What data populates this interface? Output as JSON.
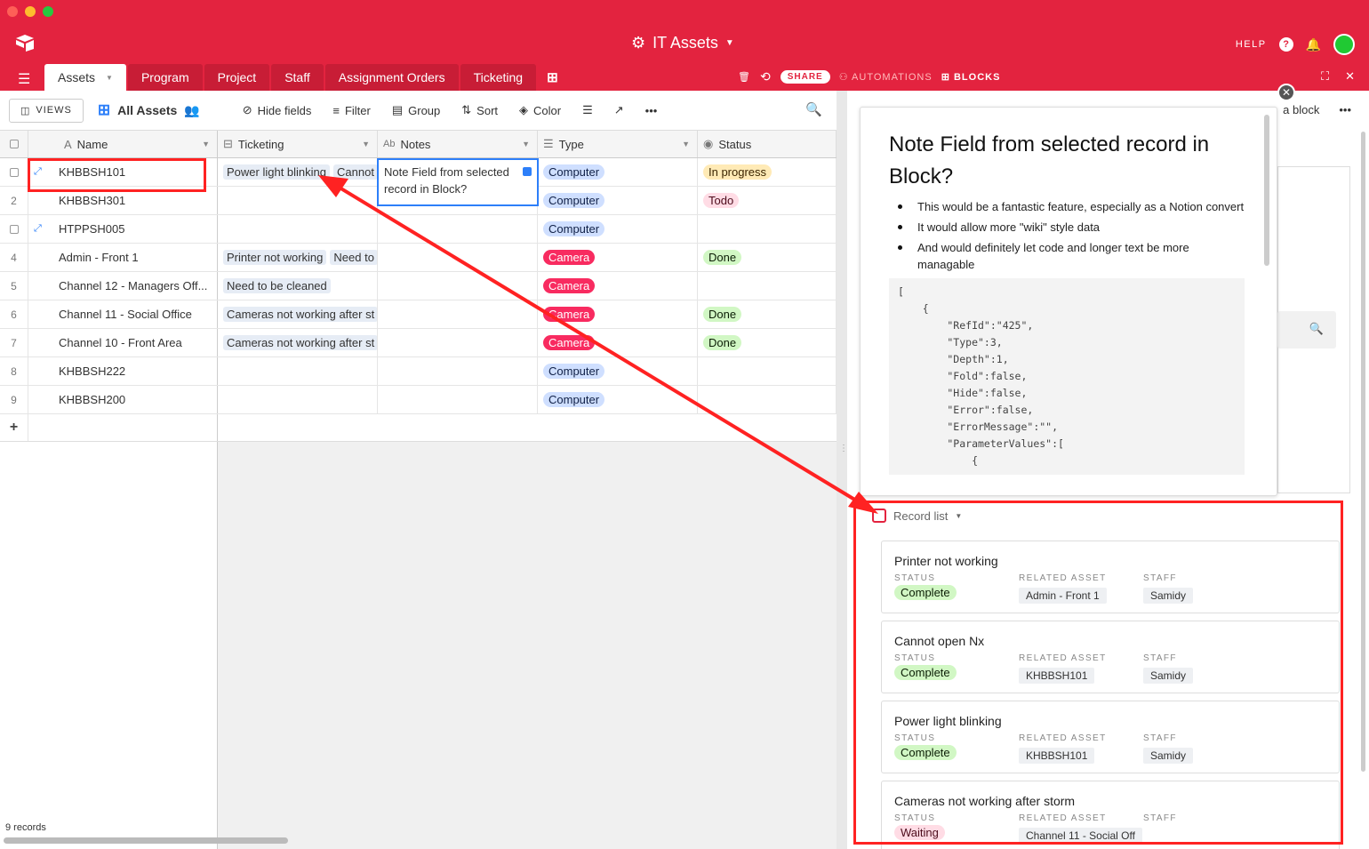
{
  "app": {
    "title": "IT Assets",
    "help": "HELP"
  },
  "tabs": [
    "Assets",
    "Program",
    "Project",
    "Staff",
    "Assignment Orders",
    "Ticketing"
  ],
  "toolbar": {
    "share": "SHARE",
    "automations": "AUTOMATIONS",
    "blocks": "BLOCKS"
  },
  "view": {
    "views_label": "VIEWS",
    "name": "All Assets",
    "tools": [
      "Hide fields",
      "Filter",
      "Group",
      "Sort",
      "Color"
    ]
  },
  "columns": [
    "Name",
    "Ticketing",
    "Notes",
    "Type",
    "Status"
  ],
  "rows": [
    {
      "num": "",
      "name": "KHBBSH101",
      "tickets": [
        "Power light blinking",
        "Cannot"
      ],
      "notes": "",
      "type": "Computer",
      "status": "In progress"
    },
    {
      "num": "2",
      "name": "KHBBSH301",
      "tickets": [],
      "notes": "",
      "type": "Computer",
      "status": "Todo"
    },
    {
      "num": "",
      "name": "HTPPSH005",
      "tickets": [],
      "notes": "",
      "type": "Computer",
      "status": ""
    },
    {
      "num": "4",
      "name": "Admin - Front 1",
      "tickets": [
        "Printer not working",
        "Need to"
      ],
      "notes": "",
      "type": "Camera",
      "status": "Done"
    },
    {
      "num": "5",
      "name": "Channel 12 - Managers Off...",
      "tickets": [
        "Need to be cleaned"
      ],
      "notes": "",
      "type": "Camera",
      "status": ""
    },
    {
      "num": "6",
      "name": "Channel 11 - Social Office",
      "tickets": [
        "Cameras not working after st"
      ],
      "notes": "",
      "type": "Camera",
      "status": "Done"
    },
    {
      "num": "7",
      "name": "Channel 10 - Front Area",
      "tickets": [
        "Cameras not working after st"
      ],
      "notes": "",
      "type": "Camera",
      "status": "Done"
    },
    {
      "num": "8",
      "name": "KHBBSH222",
      "tickets": [],
      "notes": "",
      "type": "Computer",
      "status": ""
    },
    {
      "num": "9",
      "name": "KHBBSH200",
      "tickets": [],
      "notes": "",
      "type": "Computer",
      "status": ""
    }
  ],
  "add_row": "+",
  "expanded_note": "Note Field from selected record in Block?",
  "footer": "9 records",
  "right_header": {
    "add_block": "a block",
    "more": "•••"
  },
  "block": {
    "title": "Note Field from selected record in Block?",
    "bullets": [
      "This would be a fantastic feature, especially as a Notion convert",
      "It would allow more \"wiki\" style data",
      "And would definitely let code and longer text be more managable"
    ],
    "code": "[\n    {\n        \"RefId\":\"425\",\n        \"Type\":3,\n        \"Depth\":1,\n        \"Fold\":false,\n        \"Hide\":false,\n        \"Error\":false,\n        \"ErrorMessage\":\"\",\n        \"ParameterValues\":[\n            {"
  },
  "record_list": {
    "label": "Record list",
    "labels": {
      "status": "STATUS",
      "asset": "RELATED ASSET",
      "staff": "STAFF"
    },
    "items": [
      {
        "title": "Printer not working",
        "status": "Complete",
        "asset": "Admin - Front 1",
        "staff": "Samidy"
      },
      {
        "title": "Cannot open Nx",
        "status": "Complete",
        "asset": "KHBBSH101",
        "staff": "Samidy"
      },
      {
        "title": "Power light blinking",
        "status": "Complete",
        "asset": "KHBBSH101",
        "staff": "Samidy"
      },
      {
        "title": "Cameras not working after storm",
        "status": "Waiting",
        "asset": "Channel 11 - Social Off",
        "staff": ""
      }
    ]
  },
  "colors": {
    "brand": "#e3233f",
    "annotation": "#ff2222",
    "selection": "#2d7ff9"
  }
}
